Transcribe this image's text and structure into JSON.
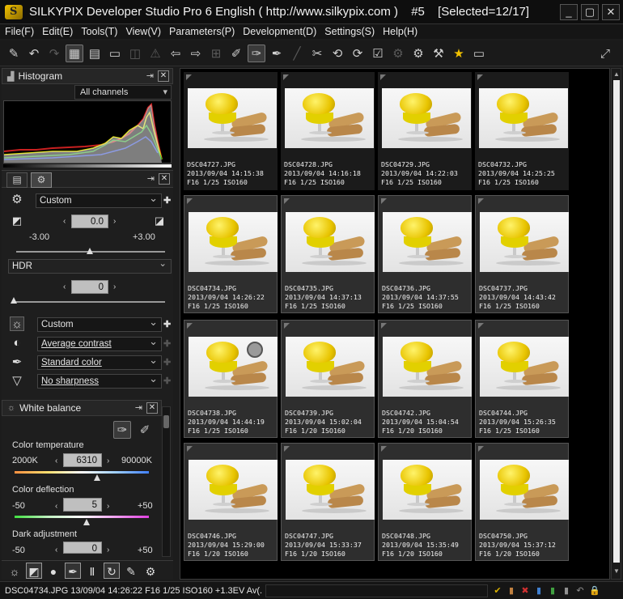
{
  "window": {
    "app_title": "SILKYPIX Developer Studio Pro 6 English ( http://www.silkypix.com )",
    "file_index": "#5",
    "selection": "[Selected=12/17]",
    "controls": [
      "_",
      "▢",
      "✕"
    ]
  },
  "menu": [
    "File(F)",
    "Edit(E)",
    "Tools(T)",
    "View(V)",
    "Parameters(P)",
    "Development(D)",
    "Settings(S)",
    "Help(H)"
  ],
  "histogram": {
    "title": "Histogram",
    "channel": "All channels"
  },
  "exposure": {
    "taste": "Custom",
    "value": "0.0",
    "min": "-3.00",
    "max": "+3.00",
    "level": 0.0
  },
  "hdr": {
    "label": "HDR",
    "value": "0"
  },
  "tone": {
    "taste": "Custom",
    "contrast": "Average contrast",
    "color": "Standard color",
    "sharpness": "No sharpness"
  },
  "white_balance": {
    "title": "White balance",
    "color_temp_label": "Color temperature",
    "color_temp_min": "2000K",
    "color_temp_value": "6310",
    "color_temp_max": "90000K",
    "deflection_label": "Color deflection",
    "deflection_min": "-50",
    "deflection_value": "5",
    "deflection_max": "+50",
    "dark_label": "Dark adjustment",
    "dark_min": "-50",
    "dark_value": "0",
    "dark_max": "+50"
  },
  "thumbnails": [
    {
      "name": "DSC04727.JPG",
      "date": "2013/09/04 14:15:38",
      "info": "F16 1/25 ISO160",
      "selected": false
    },
    {
      "name": "DSC04728.JPG",
      "date": "2013/09/04 14:16:18",
      "info": "F16 1/25 ISO160",
      "selected": false
    },
    {
      "name": "DSC04729.JPG",
      "date": "2013/09/04 14:22:03",
      "info": "F16 1/25 ISO160",
      "selected": false
    },
    {
      "name": "DSC04732.JPG",
      "date": "2013/09/04 14:25:25",
      "info": "F16 1/25 ISO160",
      "selected": false
    },
    {
      "name": "DSC04734.JPG",
      "date": "2013/09/04 14:26:22",
      "info": "F16 1/25 ISO160",
      "selected": true
    },
    {
      "name": "DSC04735.JPG",
      "date": "2013/09/04 14:37:13",
      "info": "F16 1/25 ISO160",
      "selected": true
    },
    {
      "name": "DSC04736.JPG",
      "date": "2013/09/04 14:37:55",
      "info": "F16 1/25 ISO160",
      "selected": true
    },
    {
      "name": "DSC04737.JPG",
      "date": "2013/09/04 14:43:42",
      "info": "F16 1/25 ISO160",
      "selected": true
    },
    {
      "name": "DSC04738.JPG",
      "date": "2013/09/04 14:44:19",
      "info": "F16 1/25 ISO160",
      "selected": true
    },
    {
      "name": "DSC04739.JPG",
      "date": "2013/09/04 15:02:04",
      "info": "F16 1/20 ISO160",
      "selected": true
    },
    {
      "name": "DSC04742.JPG",
      "date": "2013/09/04 15:04:54",
      "info": "F16 1/20 ISO160",
      "selected": true
    },
    {
      "name": "DSC04744.JPG",
      "date": "2013/09/04 15:26:35",
      "info": "F16 1/25 ISO160",
      "selected": true
    },
    {
      "name": "DSC04746.JPG",
      "date": "2013/09/04 15:29:00",
      "info": "F16 1/20 ISO160",
      "selected": true
    },
    {
      "name": "DSC04747.JPG",
      "date": "2013/09/04 15:33:37",
      "info": "F16 1/20 ISO160",
      "selected": true
    },
    {
      "name": "DSC04748.JPG",
      "date": "2013/09/04 15:35:49",
      "info": "F16 1/20 ISO160",
      "selected": true
    },
    {
      "name": "DSC04750.JPG",
      "date": "2013/09/04 15:37:12",
      "info": "F16 1/20 ISO160",
      "selected": true
    }
  ],
  "status": {
    "text": "DSC04734.JPG 13/09/04 14:26:22 F16 1/25 ISO160 +1.3EV Av(..."
  },
  "colors": {
    "background": "#1c1c1c",
    "grid_background": "#000000",
    "accent_yellow": "#f2c200"
  }
}
